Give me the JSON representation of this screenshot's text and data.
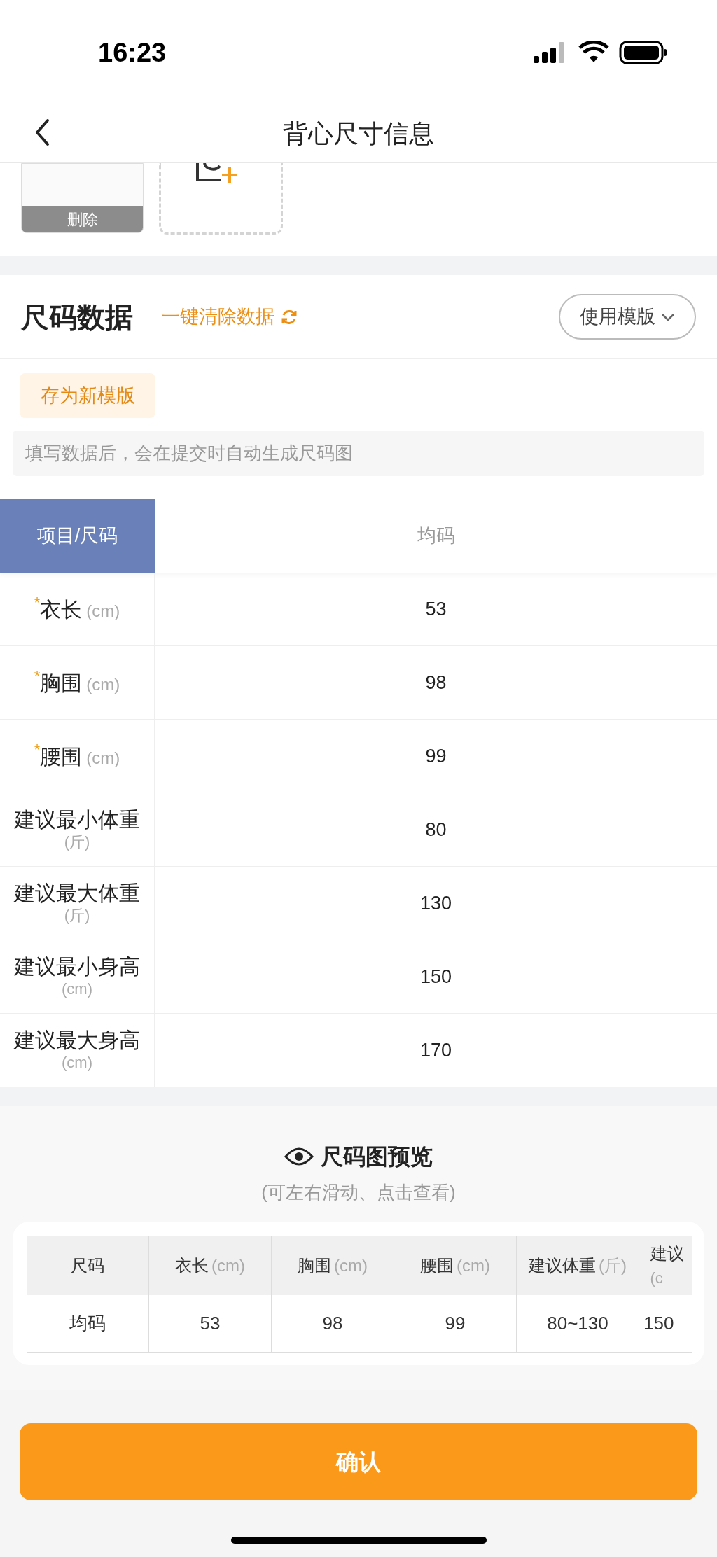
{
  "status_bar": {
    "time": "16:23"
  },
  "nav": {
    "title": "背心尺寸信息"
  },
  "photos": {
    "delete_label": "删除"
  },
  "size_data": {
    "title": "尺码数据",
    "clear_link": "一键清除数据",
    "template_button": "使用模版",
    "save_button": "存为新模版",
    "hint": "填写数据后，会在提交时自动生成尺码图"
  },
  "table": {
    "corner": "项目/尺码",
    "columns": [
      "均码"
    ],
    "rows": [
      {
        "required_mark": "*",
        "label": "衣长",
        "unit": "(cm)",
        "kind": "inline",
        "value": "53"
      },
      {
        "required_mark": "*",
        "label": "胸围",
        "unit": "(cm)",
        "kind": "inline",
        "value": "98"
      },
      {
        "required_mark": "*",
        "label": "腰围",
        "unit": "(cm)",
        "kind": "inline",
        "value": "99"
      },
      {
        "label": "建议最小体重",
        "unit": "(斤)",
        "kind": "stacked",
        "value": "80"
      },
      {
        "label": "建议最大体重",
        "unit": "(斤)",
        "kind": "stacked",
        "value": "130"
      },
      {
        "label": "建议最小身高",
        "unit": "(cm)",
        "kind": "stacked",
        "value": "150"
      },
      {
        "label": "建议最大身高",
        "unit": "(cm)",
        "kind": "stacked",
        "value": "170"
      }
    ]
  },
  "preview": {
    "title": "尺码图预览",
    "subtitle": "(可左右滑动、点击查看)",
    "columns": [
      {
        "label": "尺码",
        "kind": "inline"
      },
      {
        "label": "衣长",
        "unit": "(cm)",
        "kind": "inline"
      },
      {
        "label": "胸围",
        "unit": "(cm)",
        "kind": "inline"
      },
      {
        "label": "腰围",
        "unit": "(cm)",
        "kind": "inline"
      },
      {
        "label": "建议体重",
        "unit": "(斤)",
        "kind": "inline"
      },
      {
        "label": "建议",
        "unit": "(c",
        "kind": "stacked"
      }
    ],
    "rows": [
      [
        "均码",
        "53",
        "98",
        "99",
        "80~130",
        "150"
      ]
    ]
  },
  "confirm_button": "确认"
}
